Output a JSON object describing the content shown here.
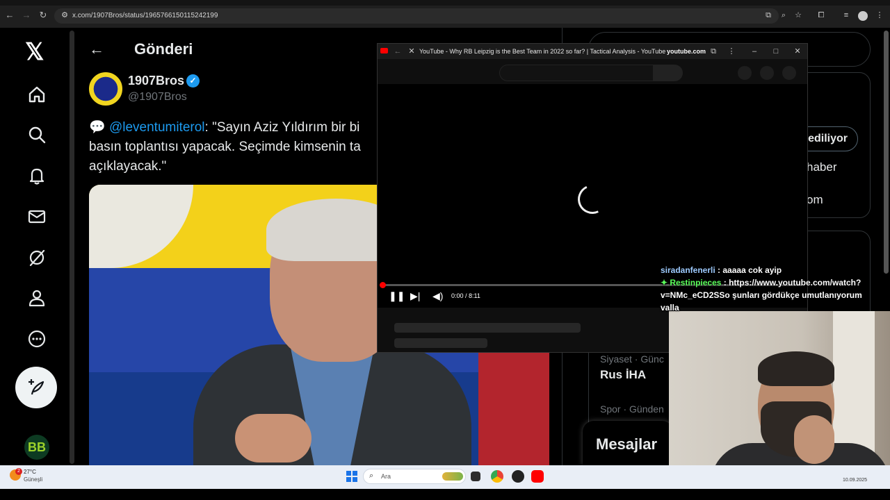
{
  "browser": {
    "url": "x.com/1907Bros/status/1965766150115242199"
  },
  "sidebar": {
    "items": [
      {
        "name": "home",
        "icon": "home-icon"
      },
      {
        "name": "explore",
        "icon": "search-icon"
      },
      {
        "name": "notifications",
        "icon": "bell-icon"
      },
      {
        "name": "messages",
        "icon": "mail-icon"
      },
      {
        "name": "grok",
        "icon": "grok-icon"
      },
      {
        "name": "profile",
        "icon": "person-icon"
      },
      {
        "name": "more",
        "icon": "more-icon"
      }
    ],
    "avatar_initials": "BB"
  },
  "post": {
    "page_title": "Gönderi",
    "author_name": "1907Bros",
    "author_handle": "@1907Bros",
    "text_icon": "💬",
    "mention": "@leventumiterol",
    "text_rest": ": \"Sayın Aziz Yıldırım bir bi",
    "text_line2": "basın toplantısı yapacak. Seçimde kimsenin ta",
    "text_line3": "açıklayacak.\""
  },
  "right_column": {
    "follow_label": "ediliyor",
    "text1": "haber",
    "text2": "om",
    "trend1_category": "Siyaset · Günc",
    "trend1_title": "Rus İHA",
    "trend2_category": "Spor · Günden",
    "messages_label": "Mesajlar"
  },
  "pip": {
    "title": "YouTube - Why RB Leipzig is the Best Team in 2022 so far? | Tactical Analysis - YouTube",
    "domain": "youtube.com",
    "time": "0:00 / 8:11",
    "progress_fraction": 0.0
  },
  "chat": {
    "messages": [
      {
        "user": "siradanfenerli",
        "text": " : aaaaa cok ayip"
      },
      {
        "user": "Restinpieces",
        "text": " : https://www.youtube.com/watch?v=NMc_eCD2SSo şunları gördükçe umutlanıyorum valla"
      }
    ]
  },
  "taskbar": {
    "weather_badge": "2",
    "weather_temp": "27°C",
    "weather_desc": "Güneşli",
    "search_placeholder": "Ara",
    "date": "10.09.2025"
  },
  "colors": {
    "accent": "#1d9bf0",
    "youtube_red": "#ff0000",
    "background": "#000000"
  }
}
